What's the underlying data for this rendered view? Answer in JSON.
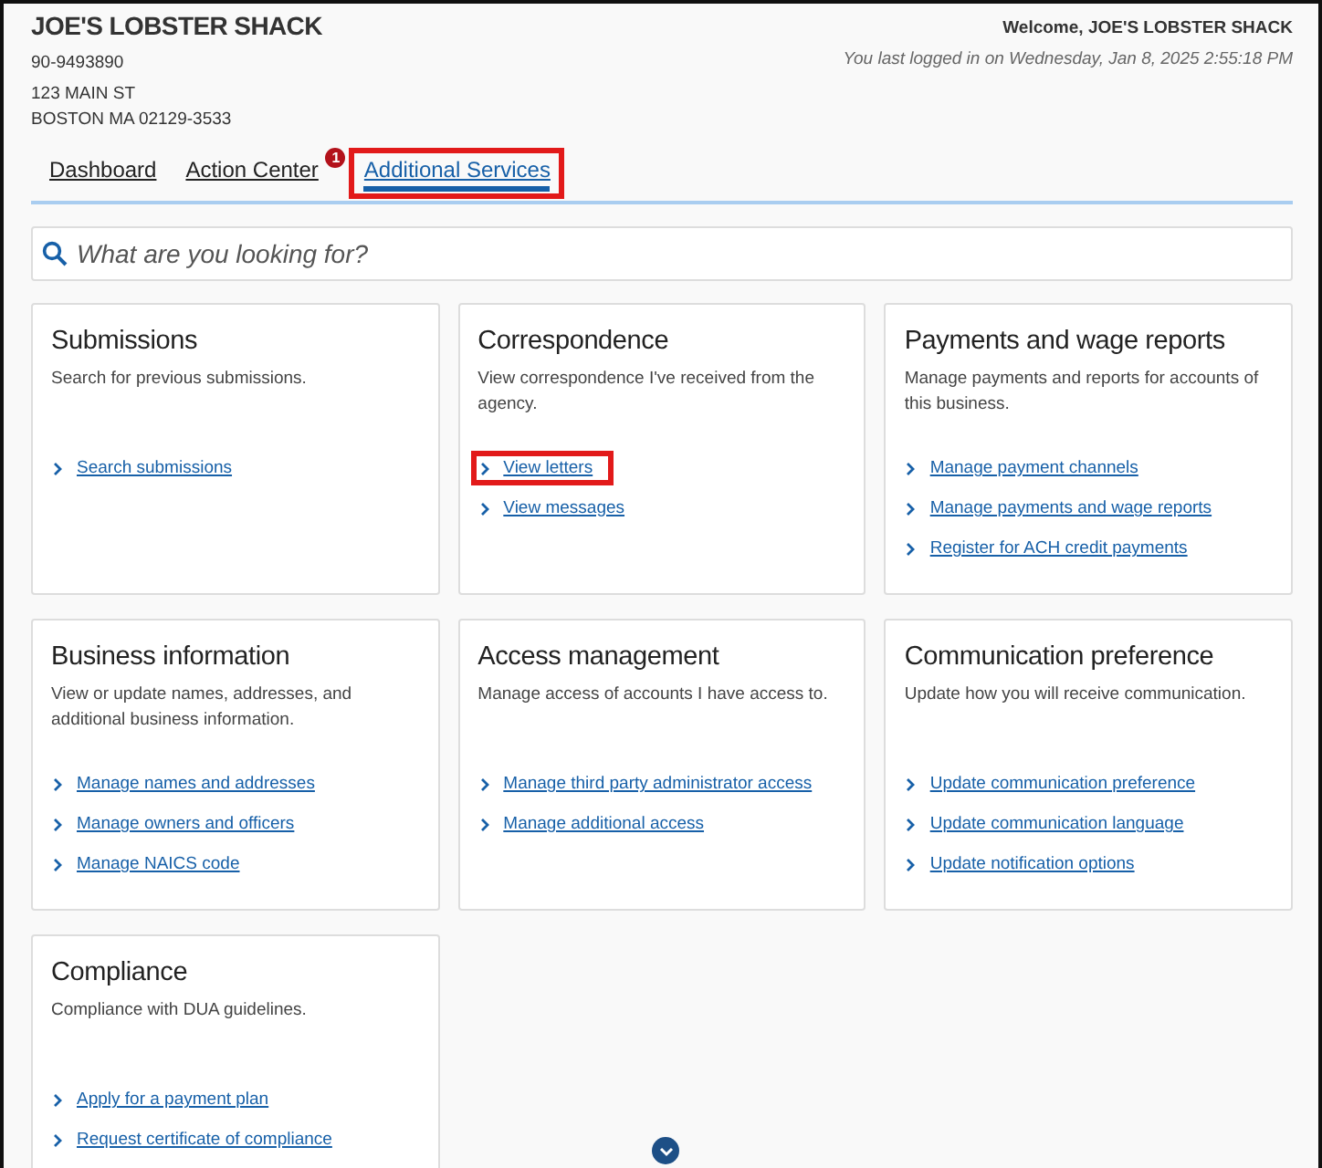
{
  "header": {
    "business_name": "JOE'S LOBSTER SHACK",
    "ein": "90-9493890",
    "address_lines": [
      "123 MAIN ST",
      "BOSTON MA 02129-3533"
    ],
    "welcome": "Welcome, JOE'S LOBSTER SHACK",
    "last_login": "You last logged in on Wednesday, Jan 8, 2025 2:55:18 PM"
  },
  "tabs": [
    {
      "label": "Dashboard",
      "selected": false,
      "highlighted": false
    },
    {
      "label": "Action Center",
      "selected": false,
      "highlighted": false,
      "badge": "1"
    },
    {
      "label": "Additional Services",
      "selected": true,
      "highlighted": true
    }
  ],
  "search": {
    "placeholder": "What are you looking for?"
  },
  "cards": [
    {
      "title": "Submissions",
      "description": "Search for previous submissions.",
      "links": [
        {
          "label": "Search submissions",
          "highlighted": false
        }
      ]
    },
    {
      "title": "Correspondence",
      "description": "View correspondence I've received from the agency.",
      "links": [
        {
          "label": "View letters",
          "highlighted": true
        },
        {
          "label": "View messages",
          "highlighted": false
        }
      ]
    },
    {
      "title": "Payments and wage reports",
      "description": "Manage payments and reports for accounts of this business.",
      "links": [
        {
          "label": "Manage payment channels",
          "highlighted": false
        },
        {
          "label": "Manage payments and wage reports",
          "highlighted": false
        },
        {
          "label": "Register for ACH credit payments",
          "highlighted": false
        }
      ]
    },
    {
      "title": "Business information",
      "description": "View or update names, addresses, and additional business information.",
      "links": [
        {
          "label": "Manage names and addresses",
          "highlighted": false
        },
        {
          "label": "Manage owners and officers",
          "highlighted": false
        },
        {
          "label": "Manage NAICS code",
          "highlighted": false
        }
      ]
    },
    {
      "title": "Access management",
      "description": "Manage access of accounts I have access to.",
      "links": [
        {
          "label": "Manage third party administrator access",
          "highlighted": false
        },
        {
          "label": "Manage additional access",
          "highlighted": false
        }
      ]
    },
    {
      "title": "Communication preference",
      "description": "Update how you will receive communication.",
      "links": [
        {
          "label": "Update communication preference",
          "highlighted": false
        },
        {
          "label": "Update communication language",
          "highlighted": false
        },
        {
          "label": "Update notification options",
          "highlighted": false
        }
      ]
    },
    {
      "title": "Compliance",
      "description": "Compliance with DUA guidelines.",
      "links": [
        {
          "label": "Apply for a payment plan",
          "highlighted": false
        },
        {
          "label": "Request certificate of compliance",
          "highlighted": false
        }
      ]
    }
  ]
}
